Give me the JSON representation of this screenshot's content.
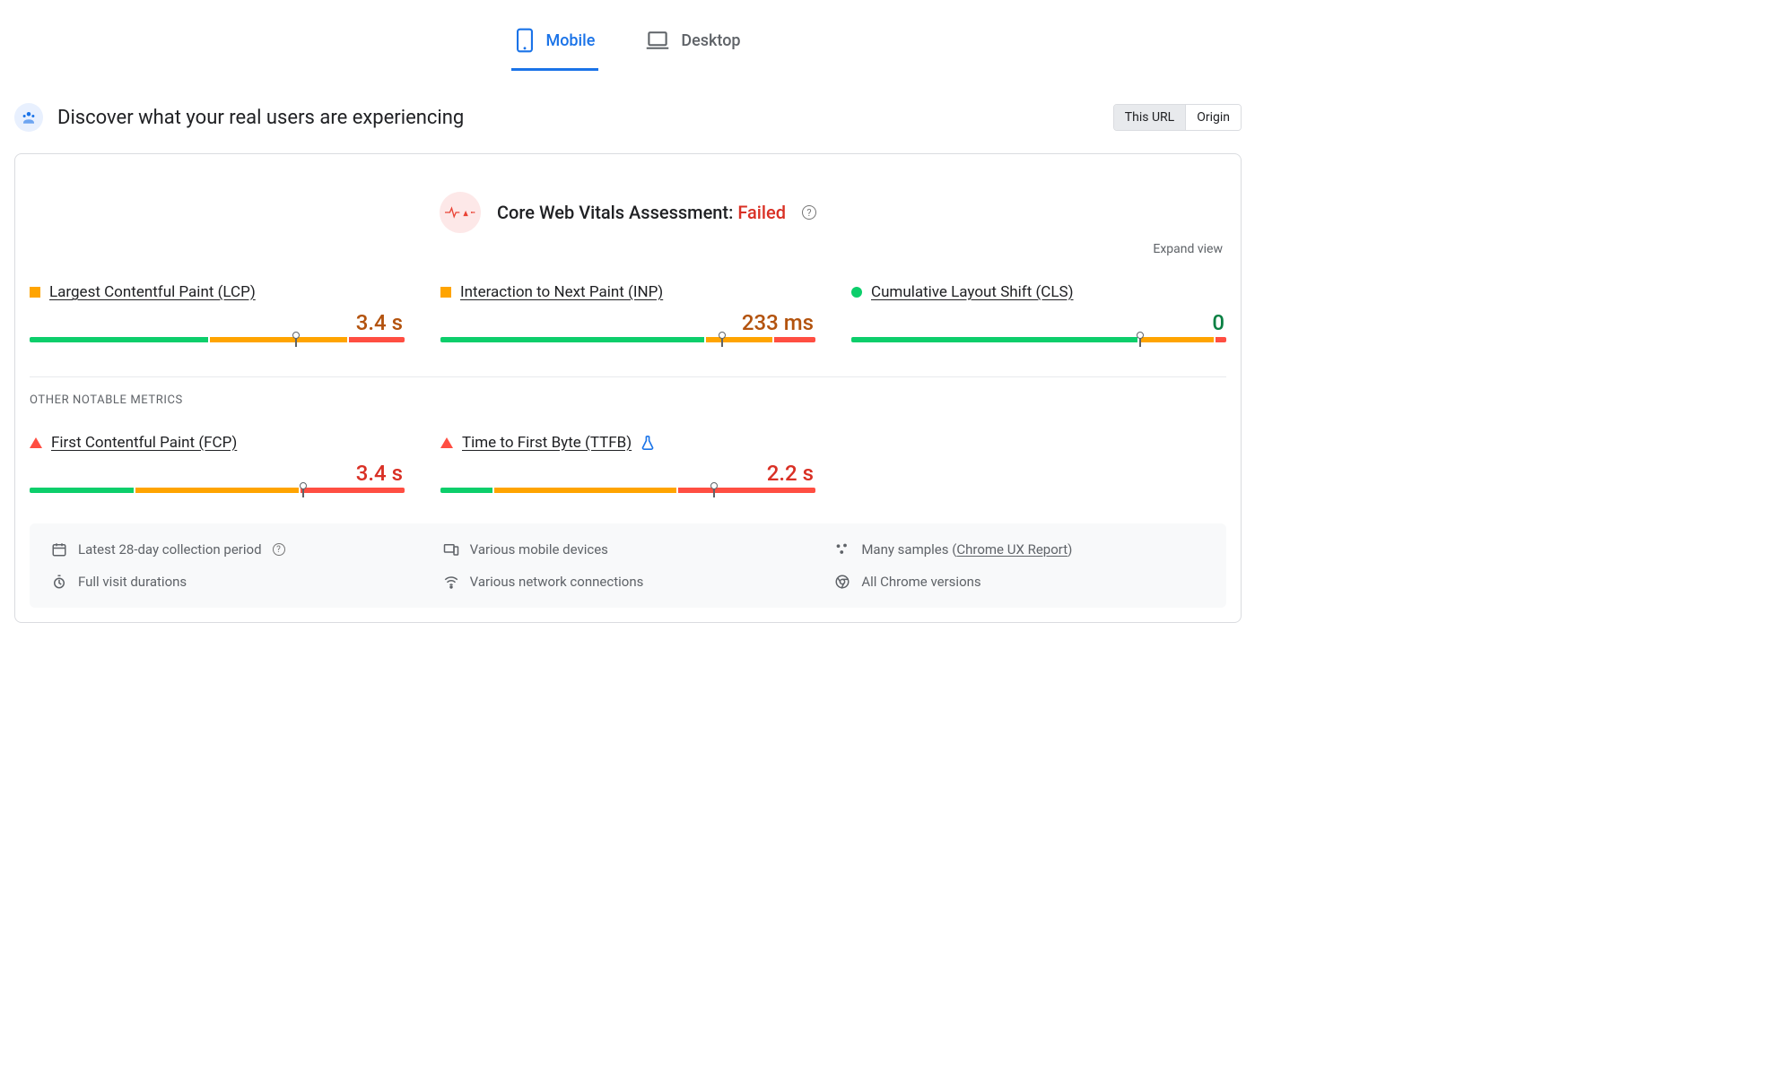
{
  "tabs": {
    "mobile": "Mobile",
    "desktop": "Desktop",
    "active": "mobile"
  },
  "header": {
    "title": "Discover what your real users are experiencing",
    "seg_this_url": "This URL",
    "seg_origin": "Origin",
    "seg_active": "this_url"
  },
  "assessment": {
    "label": "Core Web Vitals Assessment:",
    "status": "Failed",
    "help_glyph": "?"
  },
  "expand_label": "Expand view",
  "other_label": "OTHER NOTABLE METRICS",
  "chart_data": [
    {
      "id": "lcp",
      "type": "bar",
      "name": "Largest Contentful Paint (LCP)",
      "status": "needs-improvement",
      "value_display": "3.4 s",
      "value": 3.4,
      "unit": "s",
      "distribution": {
        "good": 48,
        "needs_improvement": 37,
        "poor": 15
      },
      "marker_pct": 71
    },
    {
      "id": "inp",
      "type": "bar",
      "name": "Interaction to Next Paint (INP)",
      "status": "needs-improvement",
      "value_display": "233 ms",
      "value": 233,
      "unit": "ms",
      "distribution": {
        "good": 71,
        "needs_improvement": 18,
        "poor": 11
      },
      "marker_pct": 75
    },
    {
      "id": "cls",
      "type": "bar",
      "name": "Cumulative Layout Shift (CLS)",
      "status": "good",
      "value_display": "0",
      "value": 0,
      "unit": "",
      "distribution": {
        "good": 77,
        "needs_improvement": 20,
        "poor": 3
      },
      "marker_pct": 77
    },
    {
      "id": "fcp",
      "type": "bar",
      "name": "First Contentful Paint (FCP)",
      "status": "poor",
      "value_display": "3.4 s",
      "value": 3.4,
      "unit": "s",
      "distribution": {
        "good": 28,
        "needs_improvement": 44,
        "poor": 28
      },
      "marker_pct": 73
    },
    {
      "id": "ttfb",
      "type": "bar",
      "name": "Time to First Byte (TTFB)",
      "status": "poor",
      "value_display": "2.2 s",
      "value": 2.2,
      "unit": "s",
      "distribution": {
        "good": 14,
        "needs_improvement": 49,
        "poor": 37
      },
      "marker_pct": 73,
      "experimental": true
    }
  ],
  "footer": {
    "period": "Latest 28-day collection period",
    "devices": "Various mobile devices",
    "samples_prefix": "Many samples (",
    "samples_link": "Chrome UX Report",
    "samples_suffix": ")",
    "durations": "Full visit durations",
    "network": "Various network connections",
    "versions": "All Chrome versions"
  }
}
